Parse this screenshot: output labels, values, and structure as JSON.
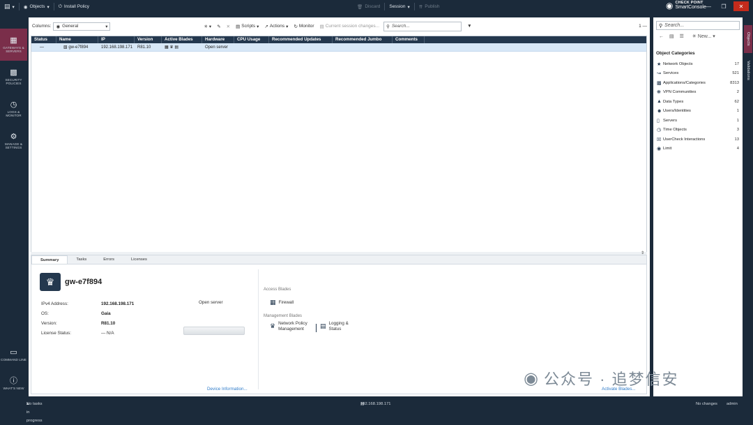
{
  "topbar": {
    "menu_icon": "app-menu-icon",
    "objects_label": "Objects",
    "install_policy_label": "Install Policy",
    "discard_label": "Discard",
    "session_label": "Session",
    "publish_label": "Publish",
    "brand_line1": "CHECK POINT",
    "brand_line2": "SmartConsole"
  },
  "leftnav": {
    "items": [
      {
        "label": "GATEWAYS & SERVERS",
        "icon": "gateways-icon"
      },
      {
        "label": "SECURITY POLICIES",
        "icon": "policies-icon"
      },
      {
        "label": "LOGS & MONITOR",
        "icon": "logs-icon"
      },
      {
        "label": "MANAGE & SETTINGS",
        "icon": "settings-icon"
      },
      {
        "label": "COMMAND LINE",
        "icon": "command-line-icon"
      },
      {
        "label": "WHAT'S NEW",
        "icon": "help-icon"
      }
    ]
  },
  "toolbar": {
    "columns_label": "Columns:",
    "columns_value": "General",
    "scripts_label": "Scripts",
    "actions_label": "Actions",
    "monitor_label": "Monitor",
    "session_changes_label": "Current session changes...",
    "search_placeholder": "Search...",
    "count_label": "1 —"
  },
  "grid": {
    "columns": [
      "Status",
      "Name",
      "IP",
      "Version",
      "Active Blades",
      "Hardware",
      "CPU Usage",
      "Recommended Updates",
      "Recommended Jumbo",
      "Comments"
    ],
    "rows": [
      {
        "status": "—",
        "name": "gw-e7f894",
        "ip": "192.168.198.171",
        "version": "R81.10",
        "hardware": "Open server",
        "cpu": "",
        "updates": "",
        "jumbo": "",
        "comments": ""
      }
    ]
  },
  "detail": {
    "tabs": [
      "Summary",
      "Tasks",
      "Errors",
      "Licenses"
    ],
    "gw_name": "gw-e7f894",
    "fields": [
      {
        "label": "IPv4 Address:",
        "value": "192.168.198.171"
      },
      {
        "label": "OS:",
        "value": "Gaia"
      },
      {
        "label": "Version:",
        "value": "R81.10"
      },
      {
        "label": "License Status:",
        "value": "— N/A"
      }
    ],
    "hardware": "Open server",
    "device_info_link": "Device Information...",
    "access_blades_title": "Access Blades",
    "firewall_label": "Firewall",
    "management_blades_title": "Management Blades",
    "npm_label": "Network Policy Management",
    "logging_label": "Logging & Status",
    "activate_blades_link": "Activate Blades..."
  },
  "rightpanel": {
    "search_placeholder": "Search...",
    "new_label": "New...",
    "categories_title": "Object Categories",
    "categories": [
      {
        "name": "Network Objects",
        "count": "17",
        "icon": "network-objects-icon"
      },
      {
        "name": "Services",
        "count": "521",
        "icon": "services-icon"
      },
      {
        "name": "Applications/Categories",
        "count": "8313",
        "icon": "applications-icon"
      },
      {
        "name": "VPN Communities",
        "count": "2",
        "icon": "vpn-icon"
      },
      {
        "name": "Data Types",
        "count": "62",
        "icon": "data-types-icon"
      },
      {
        "name": "Users/Identities",
        "count": "1",
        "icon": "users-icon"
      },
      {
        "name": "Servers",
        "count": "1",
        "icon": "servers-icon"
      },
      {
        "name": "Time Objects",
        "count": "3",
        "icon": "time-icon"
      },
      {
        "name": "UserCheck Interactions",
        "count": "13",
        "icon": "usercheck-icon"
      },
      {
        "name": "Limit",
        "count": "4",
        "icon": "limit-icon"
      }
    ],
    "vtabs": [
      "Objects",
      "Validations"
    ]
  },
  "statusbar": {
    "tasks": "No tasks in progress",
    "server": "192.168.198.171",
    "changes": "No changes",
    "user": "admin"
  },
  "watermark": "公众号 · 追梦信安",
  "colors": {
    "accent": "#7a2e4a",
    "dark": "#1b2a3a",
    "header": "#24384e",
    "selected": "#d8e8f7",
    "link": "#2e7bc9"
  }
}
